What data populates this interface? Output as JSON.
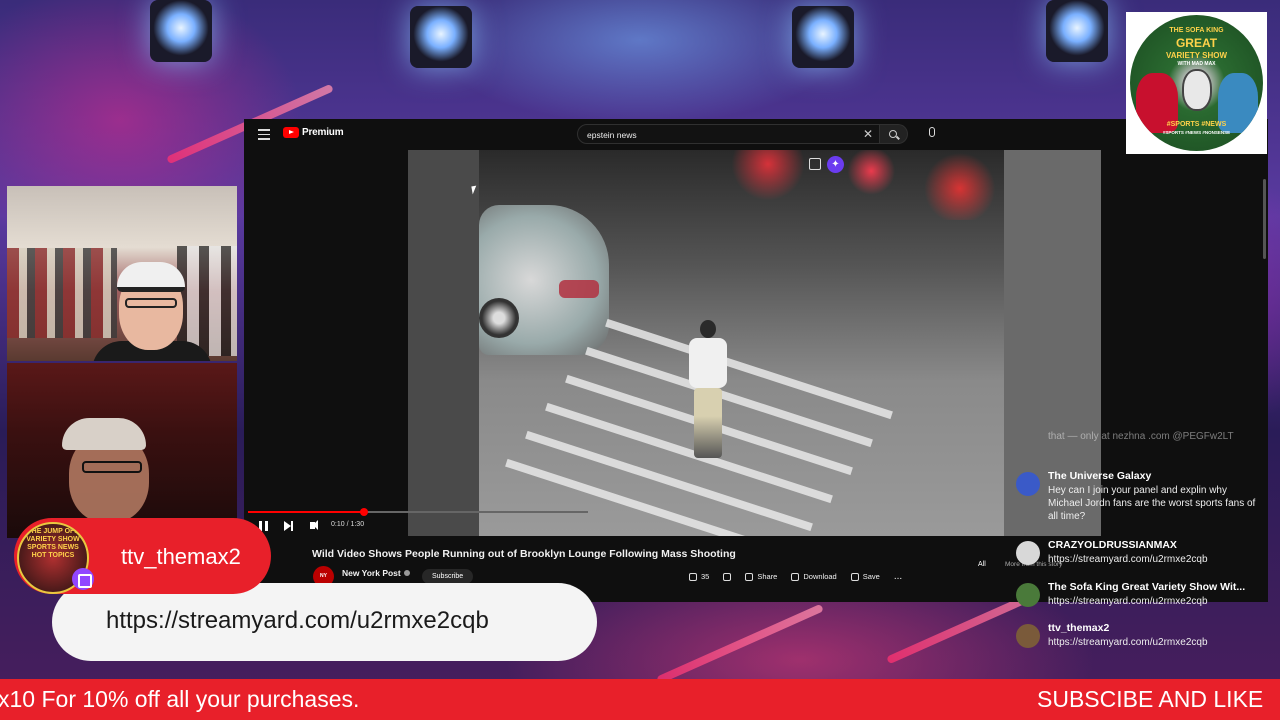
{
  "youtube": {
    "logo_text": "Premium",
    "search": {
      "value": "epstein news",
      "placeholder": "Search"
    },
    "player": {
      "time": "0:10 / 1:30",
      "progress": 0.34
    },
    "video": {
      "title": "Wild Video Shows People Running out of Brooklyn Lounge Following Mass Shooting",
      "channel": "New York Post",
      "subscribe_label": "Subscribe",
      "like_count": "35",
      "share_label": "Share",
      "download_label": "Download",
      "save_label": "Save",
      "more_label": "..."
    },
    "chips": {
      "all": "All",
      "more": "More from this story"
    }
  },
  "chat": {
    "faded_text": "that — only at nezhna .com @PEGFw2LT",
    "messages": [
      {
        "name": "The Universe Galaxy",
        "text": "Hey can I join your panel and explin why Michael Jordn fans are the worst sports fans of all time?",
        "avatar_color": "#3a5ac8"
      },
      {
        "name": "CRAZYOLDRUSSIANMAX",
        "text": "https://streamyard.com/u2rmxe2cqb",
        "avatar_color": "#d8d8d8"
      },
      {
        "name": "The Sofa King Great Variety Show Wit...",
        "text": "https://streamyard.com/u2rmxe2cqb",
        "avatar_color": "#4a7a3a"
      },
      {
        "name": "ttv_themax2",
        "text": "https://streamyard.com/u2rmxe2cqb",
        "avatar_color": "#7a5a3a"
      }
    ]
  },
  "overlay": {
    "host_name": "ttv_themax2",
    "stream_url": "https://streamyard.com/u2rmxe2cqb",
    "badge_text": "THE JUMP OFF VARIETY SHOW SPORTS NEWS HOT TOPICS",
    "ticker_left": "x10 For 10% off all your purchases.",
    "ticker_right": "SUBSCIBE AND LIKE"
  },
  "show_logo": {
    "line1": "THE SOFA KING",
    "line2": "GREAT",
    "line3": "VARIETY SHOW",
    "line4": "WITH MAD MAX",
    "line5": "#SPORTS  #NEWS",
    "line6": "#SPORTS #NEWS #NONSENSE"
  },
  "colors": {
    "accent_red": "#e8202a",
    "youtube_red": "#ff0000",
    "twitch_purple": "#9146ff"
  }
}
